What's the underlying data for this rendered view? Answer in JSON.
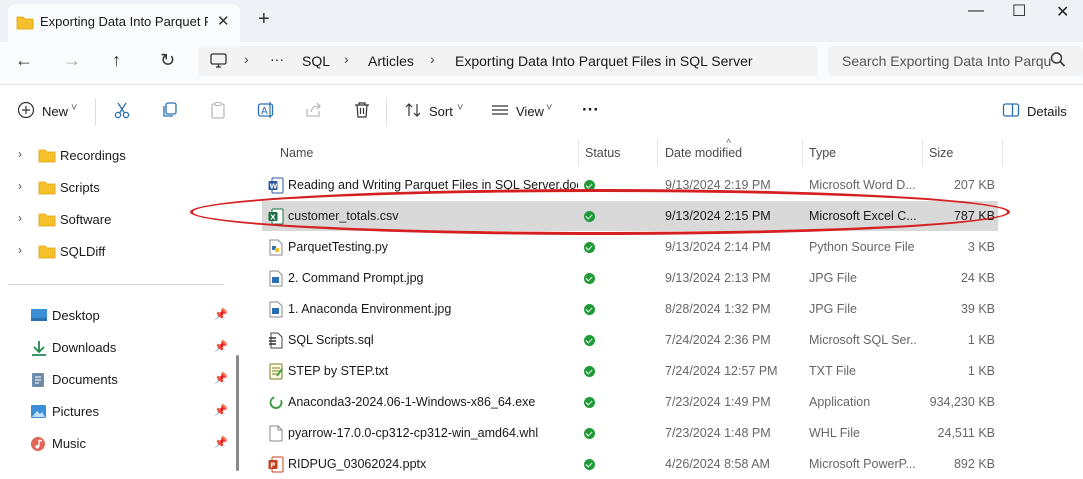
{
  "tab": {
    "title": "Exporting Data Into Parquet Fi",
    "close": "✕",
    "new_tab": "+"
  },
  "window": {
    "minimize": "—",
    "maximize": "☐",
    "close": "✕"
  },
  "nav_buttons": {
    "back": "←",
    "forward": "→",
    "up": "↑",
    "refresh": "↻"
  },
  "breadcrumb": {
    "more": "···",
    "items": [
      "SQL",
      "Articles",
      "Exporting Data Into Parquet Files in SQL Server"
    ],
    "sep": "›"
  },
  "search": {
    "placeholder": "Search Exporting Data Into Parqu"
  },
  "toolbar": {
    "new": "New",
    "sort": "Sort",
    "view": "View",
    "more": "···",
    "details": "Details",
    "dropdown": "˅"
  },
  "sidebar": {
    "folders": [
      {
        "label": "Recordings",
        "icon": "folder-icon"
      },
      {
        "label": "Scripts",
        "icon": "folder-icon"
      },
      {
        "label": "Software",
        "icon": "folder-icon"
      },
      {
        "label": "SQLDiff",
        "icon": "folder-icon"
      }
    ],
    "quick_access": [
      {
        "label": "Desktop",
        "icon": "desktop-icon"
      },
      {
        "label": "Downloads",
        "icon": "download-icon"
      },
      {
        "label": "Documents",
        "icon": "documents-icon"
      },
      {
        "label": "Pictures",
        "icon": "pictures-icon"
      },
      {
        "label": "Music",
        "icon": "music-icon"
      }
    ]
  },
  "columns": {
    "name": "Name",
    "status": "Status",
    "date": "Date modified",
    "type": "Type",
    "size": "Size"
  },
  "files": [
    {
      "name": "Reading and Writing Parquet Files in SQL Server.docx",
      "date": "9/13/2024 2:19 PM",
      "type": "Microsoft Word D...",
      "size": "207 KB",
      "icon": "word-icon"
    },
    {
      "name": "customer_totals.csv",
      "date": "9/13/2024 2:15 PM",
      "type": "Microsoft Excel C...",
      "size": "787 KB",
      "icon": "excel-icon",
      "selected": true
    },
    {
      "name": "ParquetTesting.py",
      "date": "9/13/2024 2:14 PM",
      "type": "Python Source File",
      "size": "3 KB",
      "icon": "python-icon"
    },
    {
      "name": "2. Command Prompt.jpg",
      "date": "9/13/2024 2:13 PM",
      "type": "JPG File",
      "size": "24 KB",
      "icon": "image-file-icon"
    },
    {
      "name": "1. Anaconda Environment.jpg",
      "date": "8/28/2024 1:32 PM",
      "type": "JPG File",
      "size": "39 KB",
      "icon": "image-file-icon"
    },
    {
      "name": "SQL Scripts.sql",
      "date": "7/24/2024 2:36 PM",
      "type": "Microsoft SQL Ser...",
      "size": "1 KB",
      "icon": "sql-file-icon"
    },
    {
      "name": "STEP by STEP.txt",
      "date": "7/24/2024 12:57 PM",
      "type": "TXT File",
      "size": "1 KB",
      "icon": "text-file-icon"
    },
    {
      "name": "Anaconda3-2024.06-1-Windows-x86_64.exe",
      "date": "7/23/2024 1:49 PM",
      "type": "Application",
      "size": "934,230 KB",
      "icon": "exe-icon"
    },
    {
      "name": "pyarrow-17.0.0-cp312-cp312-win_amd64.whl",
      "date": "7/23/2024 1:48 PM",
      "type": "WHL File",
      "size": "24,511 KB",
      "icon": "blank-file-icon"
    },
    {
      "name": "RIDPUG_03062024.pptx",
      "date": "4/26/2024 8:58 AM",
      "type": "Microsoft PowerP...",
      "size": "892 KB",
      "icon": "powerpoint-icon"
    }
  ],
  "colors": {
    "status_ok": "#1e9b36",
    "highlight_ring": "#d42020",
    "selection": "#d9d9d9",
    "folder": "#f4c02c"
  }
}
